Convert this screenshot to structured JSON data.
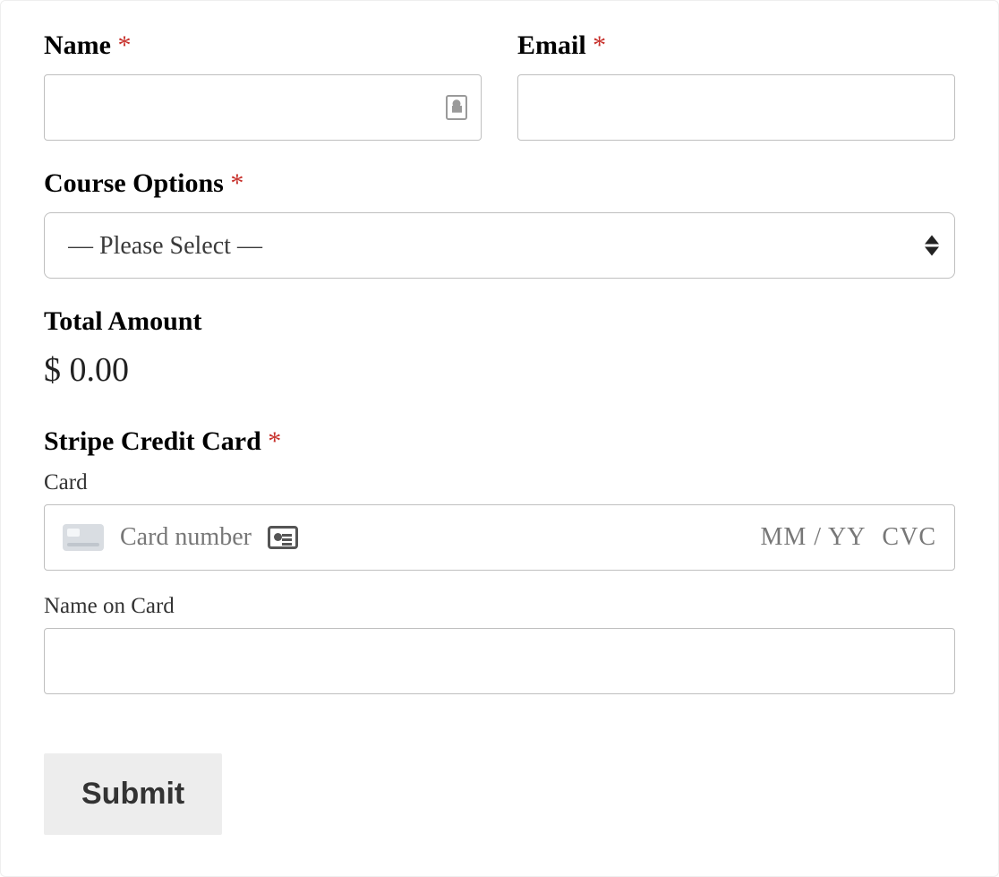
{
  "required_marker": "*",
  "name": {
    "label": "Name",
    "value": ""
  },
  "email": {
    "label": "Email",
    "value": ""
  },
  "course": {
    "label": "Course Options",
    "placeholder": "— Please Select —",
    "selected": "— Please Select —"
  },
  "total": {
    "label": "Total Amount",
    "display": "$ 0.00"
  },
  "stripe": {
    "label": "Stripe Credit Card",
    "card_sublabel": "Card",
    "card_number_placeholder": "Card number",
    "expiry_placeholder": "MM / YY",
    "cvc_placeholder": "CVC",
    "name_on_card_sublabel": "Name on Card",
    "name_on_card_value": ""
  },
  "submit_label": "Submit"
}
